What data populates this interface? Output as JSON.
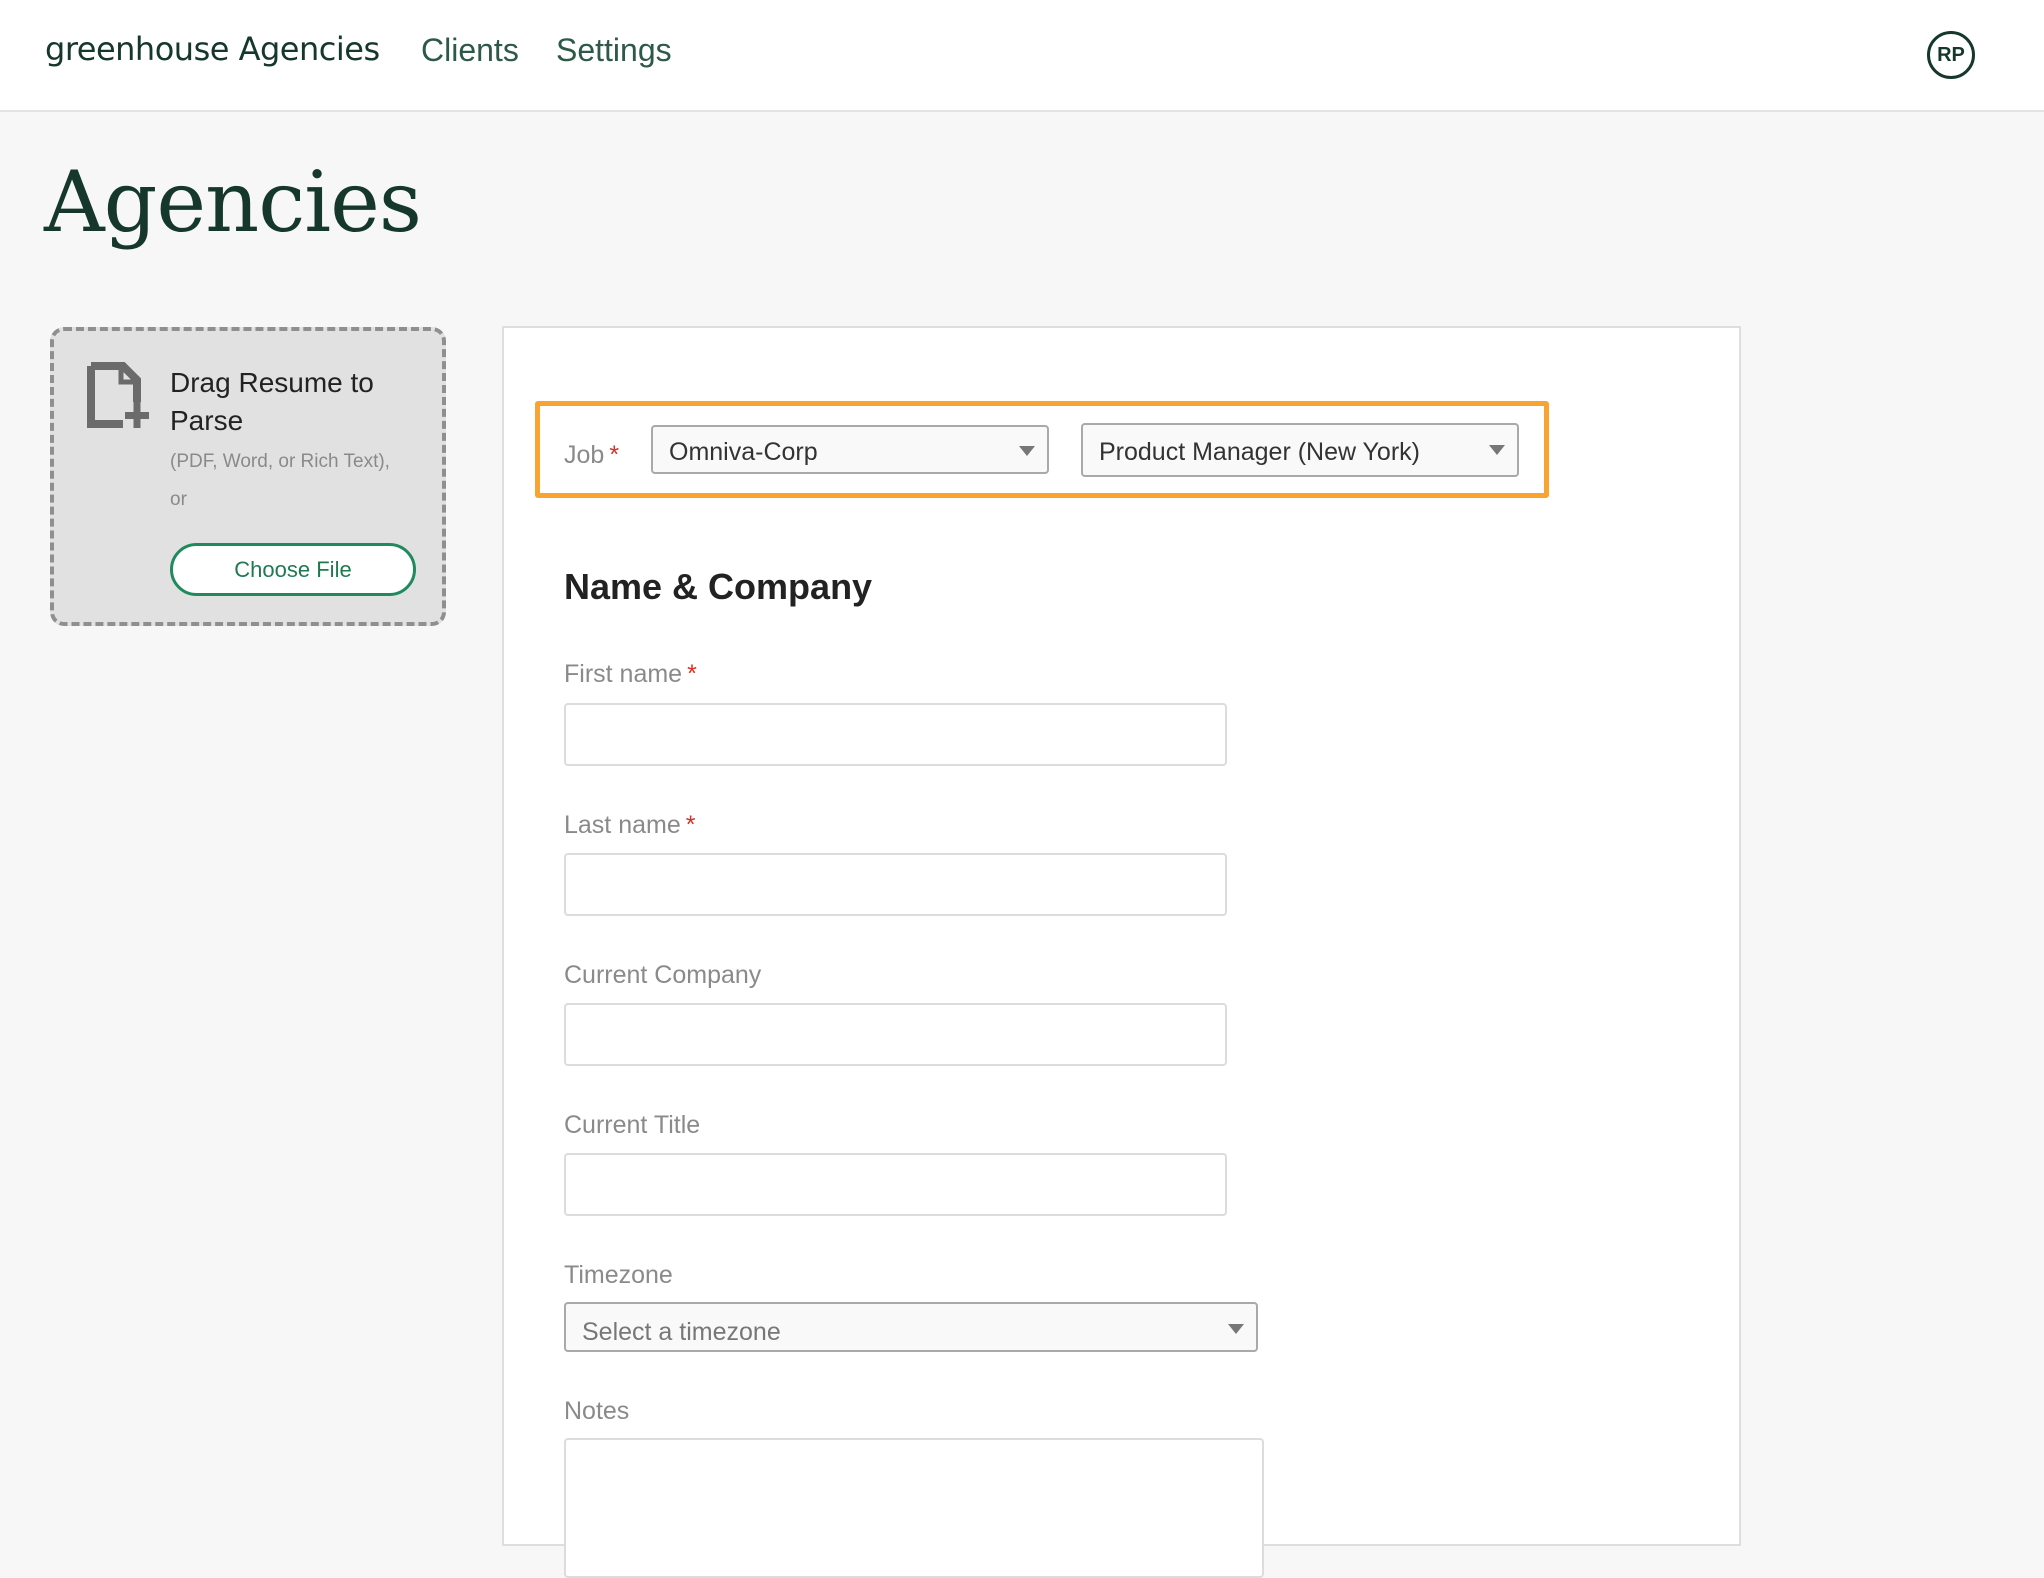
{
  "header": {
    "logo": "greenhouse Agencies",
    "nav": [
      {
        "label": "Clients"
      },
      {
        "label": "Settings"
      }
    ],
    "avatar_initials": "RP"
  },
  "page": {
    "title": "Agencies"
  },
  "dropzone": {
    "icon": "file-add-icon",
    "title": "Drag Resume to Parse",
    "subtitle": "(PDF, Word, or Rich Text),",
    "or": "or",
    "button_label": "Choose File"
  },
  "job_selector": {
    "label": "Job",
    "required_mark": "*",
    "client_value": "Omniva-Corp",
    "job_value": "Product Manager (New York)",
    "highlight_color": "#f9a331"
  },
  "form": {
    "section_heading": "Name & Company",
    "required_mark": "*",
    "fields": {
      "first_name": {
        "label": "First name",
        "value": ""
      },
      "last_name": {
        "label": "Last name",
        "value": ""
      },
      "current_company": {
        "label": "Current Company",
        "value": ""
      },
      "current_title": {
        "label": "Current Title",
        "value": ""
      },
      "timezone": {
        "label": "Timezone",
        "placeholder": "Select a timezone"
      },
      "notes": {
        "label": "Notes",
        "value": ""
      }
    }
  },
  "colors": {
    "brand_dark_green": "#15372c",
    "nav_green": "#2d5a48",
    "button_green": "#1f8a5e",
    "required_red": "#d93025"
  }
}
